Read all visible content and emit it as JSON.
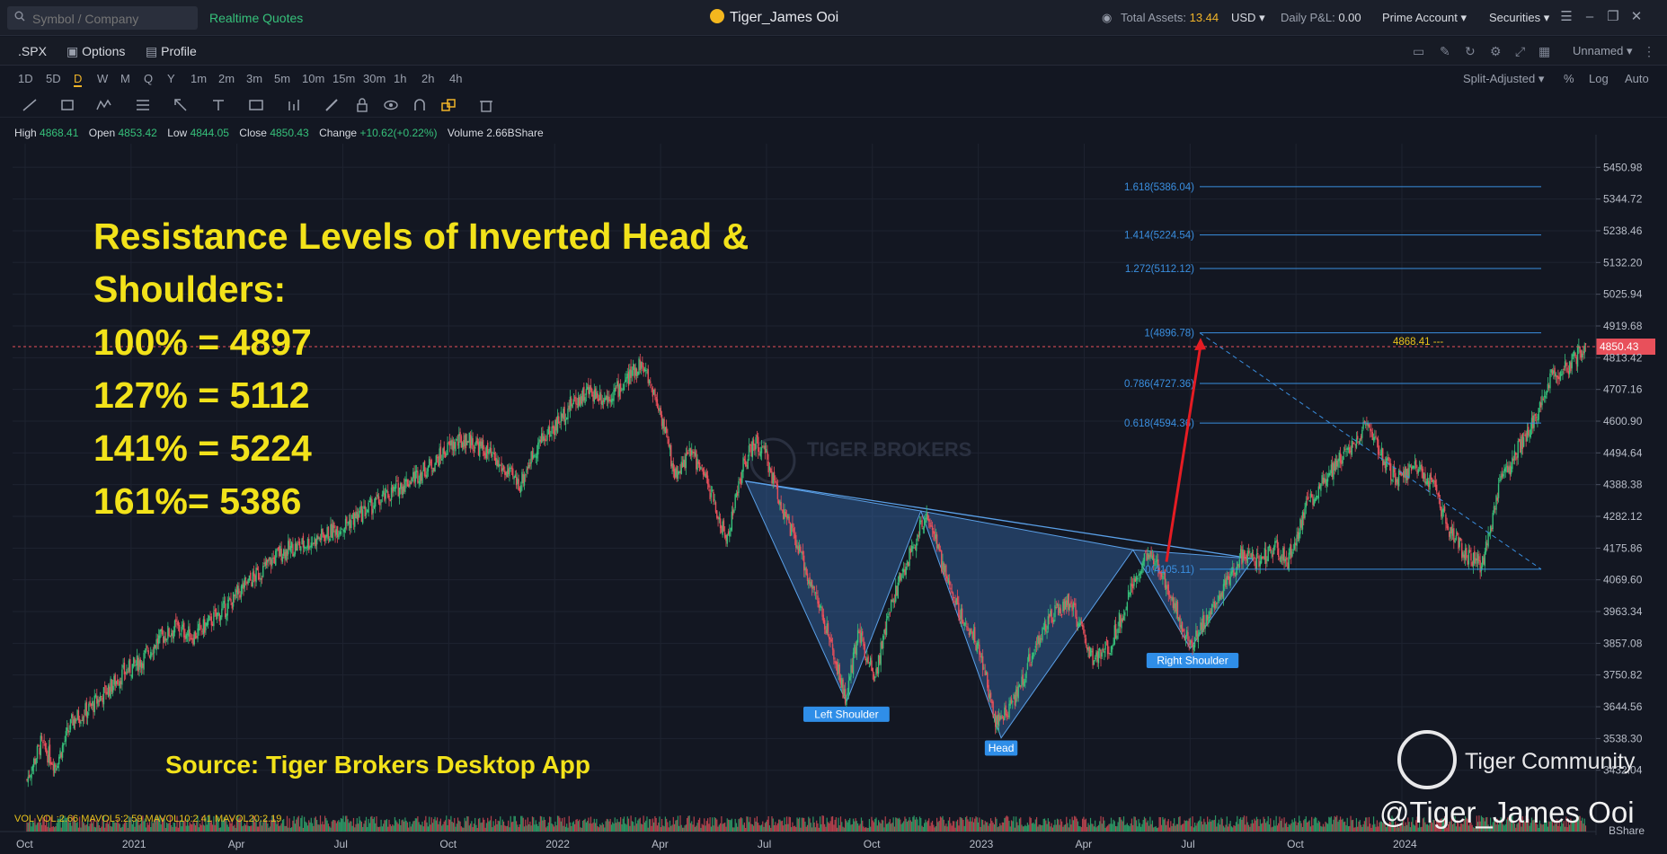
{
  "topbar": {
    "search_placeholder": "Symbol / Company",
    "realtime_quotes": "Realtime Quotes",
    "username": "Tiger_James Ooi",
    "total_assets_label": "Total Assets:",
    "total_assets_value": "13.44",
    "currency": "USD",
    "daily_pl_label": "Daily P&L:",
    "daily_pl_value": "0.00",
    "account": "Prime Account",
    "securities": "Securities"
  },
  "tabs": {
    "symbol": ".SPX",
    "options": "Options",
    "profile": "Profile",
    "layout_name": "Unnamed"
  },
  "timeframes": [
    "1D",
    "5D",
    "D",
    "W",
    "M",
    "Q",
    "Y",
    "1m",
    "2m",
    "3m",
    "5m",
    "10m",
    "15m",
    "30m",
    "1h",
    "2h",
    "4h"
  ],
  "active_timeframe": "D",
  "adjust": {
    "split": "Split-Adjusted",
    "pct": "%",
    "log": "Log",
    "auto": "Auto"
  },
  "ohlc": {
    "high_label": "High",
    "high": "4868.41",
    "open_label": "Open",
    "open": "4853.42",
    "low_label": "Low",
    "low": "4844.05",
    "close_label": "Close",
    "close": "4850.43",
    "change_label": "Change",
    "change": "+10.62(+0.22%)",
    "volume_label": "Volume",
    "volume": "2.66BShare"
  },
  "chart_data": {
    "type": "candlestick",
    "price_axis": [
      "5450.98",
      "5344.72",
      "5238.46",
      "5132.20",
      "5025.94",
      "4919.68",
      "4813.42",
      "4707.16",
      "4600.90",
      "4494.64",
      "4388.38",
      "4282.12",
      "4175.86",
      "4069.60",
      "3963.34",
      "3857.08",
      "3750.82",
      "3644.56",
      "3538.30",
      "3432.04"
    ],
    "ylim": [
      3380,
      5500
    ],
    "time_axis": [
      "Oct",
      "2021",
      "Apr",
      "Jul",
      "Oct",
      "2022",
      "Apr",
      "Jul",
      "Oct",
      "2023",
      "Apr",
      "Jul",
      "Oct",
      "2024"
    ],
    "last_price": "4850.43",
    "high_marker": "4868.41",
    "fib_levels": [
      {
        "label": "1.618(5386.04)",
        "price": 5386.04
      },
      {
        "label": "1.414(5224.54)",
        "price": 5224.54
      },
      {
        "label": "1.272(5112.12)",
        "price": 5112.12
      },
      {
        "label": "1(4896.78)",
        "price": 4896.78
      },
      {
        "label": "0.786(4727.36)",
        "price": 4727.36
      },
      {
        "label": "0.618(4594.36)",
        "price": 4594.36
      },
      {
        "label": "0(4105.11)",
        "price": 4105.11
      }
    ],
    "patterns": {
      "left_shoulder": "Left Shoulder",
      "head": "Head",
      "right_shoulder": "Right Shoulder"
    },
    "volume_axis_label": "BShare",
    "volume_legend": "VOL  VOL:2.66  MAVOL5:2.59  MAVOL10:2.41  MAVOL20:2.19",
    "close_path": [
      [
        0,
        3400
      ],
      [
        12,
        3520
      ],
      [
        25,
        3450
      ],
      [
        40,
        3600
      ],
      [
        55,
        3640
      ],
      [
        70,
        3700
      ],
      [
        85,
        3760
      ],
      [
        100,
        3800
      ],
      [
        115,
        3870
      ],
      [
        130,
        3910
      ],
      [
        145,
        3880
      ],
      [
        160,
        3930
      ],
      [
        175,
        3980
      ],
      [
        190,
        4050
      ],
      [
        205,
        4100
      ],
      [
        220,
        4160
      ],
      [
        235,
        4180
      ],
      [
        250,
        4200
      ],
      [
        265,
        4230
      ],
      [
        280,
        4260
      ],
      [
        295,
        4300
      ],
      [
        310,
        4340
      ],
      [
        325,
        4380
      ],
      [
        340,
        4420
      ],
      [
        355,
        4460
      ],
      [
        370,
        4520
      ],
      [
        385,
        4540
      ],
      [
        400,
        4500
      ],
      [
        415,
        4440
      ],
      [
        430,
        4390
      ],
      [
        445,
        4520
      ],
      [
        460,
        4580
      ],
      [
        475,
        4660
      ],
      [
        490,
        4700
      ],
      [
        505,
        4680
      ],
      [
        520,
        4720
      ],
      [
        535,
        4796
      ],
      [
        545,
        4720
      ],
      [
        555,
        4600
      ],
      [
        565,
        4420
      ],
      [
        580,
        4500
      ],
      [
        595,
        4380
      ],
      [
        610,
        4200
      ],
      [
        625,
        4450
      ],
      [
        635,
        4530
      ],
      [
        645,
        4480
      ],
      [
        660,
        4300
      ],
      [
        675,
        4150
      ],
      [
        690,
        4000
      ],
      [
        705,
        3800
      ],
      [
        715,
        3660
      ],
      [
        725,
        3900
      ],
      [
        740,
        3750
      ],
      [
        755,
        4000
      ],
      [
        770,
        4150
      ],
      [
        785,
        4300
      ],
      [
        800,
        4100
      ],
      [
        815,
        3950
      ],
      [
        830,
        3850
      ],
      [
        845,
        3600
      ],
      [
        855,
        3620
      ],
      [
        865,
        3700
      ],
      [
        880,
        3850
      ],
      [
        895,
        3950
      ],
      [
        910,
        4000
      ],
      [
        920,
        3900
      ],
      [
        930,
        3800
      ],
      [
        945,
        3850
      ],
      [
        960,
        4000
      ],
      [
        975,
        4150
      ],
      [
        990,
        4100
      ],
      [
        1005,
        3950
      ],
      [
        1015,
        3850
      ],
      [
        1030,
        3950
      ],
      [
        1045,
        4050
      ],
      [
        1060,
        4150
      ],
      [
        1075,
        4130
      ],
      [
        1090,
        4180
      ],
      [
        1100,
        4130
      ],
      [
        1115,
        4300
      ],
      [
        1130,
        4400
      ],
      [
        1145,
        4470
      ],
      [
        1160,
        4550
      ],
      [
        1170,
        4580
      ],
      [
        1180,
        4500
      ],
      [
        1195,
        4400
      ],
      [
        1210,
        4450
      ],
      [
        1225,
        4400
      ],
      [
        1240,
        4250
      ],
      [
        1255,
        4150
      ],
      [
        1270,
        4120
      ],
      [
        1285,
        4380
      ],
      [
        1300,
        4500
      ],
      [
        1315,
        4600
      ],
      [
        1330,
        4760
      ],
      [
        1345,
        4780
      ],
      [
        1360,
        4860
      ]
    ]
  },
  "annotation": {
    "line1": "Resistance Levels of Inverted Head &",
    "line2": "Shoulders:",
    "line3": "100%  = 4897",
    "line4": "127% = 5112",
    "line5": "141% = 5224",
    "line6": "161%= 5386",
    "source": "Source: Tiger Brokers Desktop App"
  },
  "watermark": {
    "community": "Tiger Community",
    "user": "@Tiger_James Ooi",
    "brand": "TIGER BROKERS"
  },
  "colors": {
    "up": "#36c07a",
    "down": "#e8505b",
    "fib": "#3a8fe0",
    "annotation": "#f2e21a",
    "price_tag": "#e8505b"
  }
}
